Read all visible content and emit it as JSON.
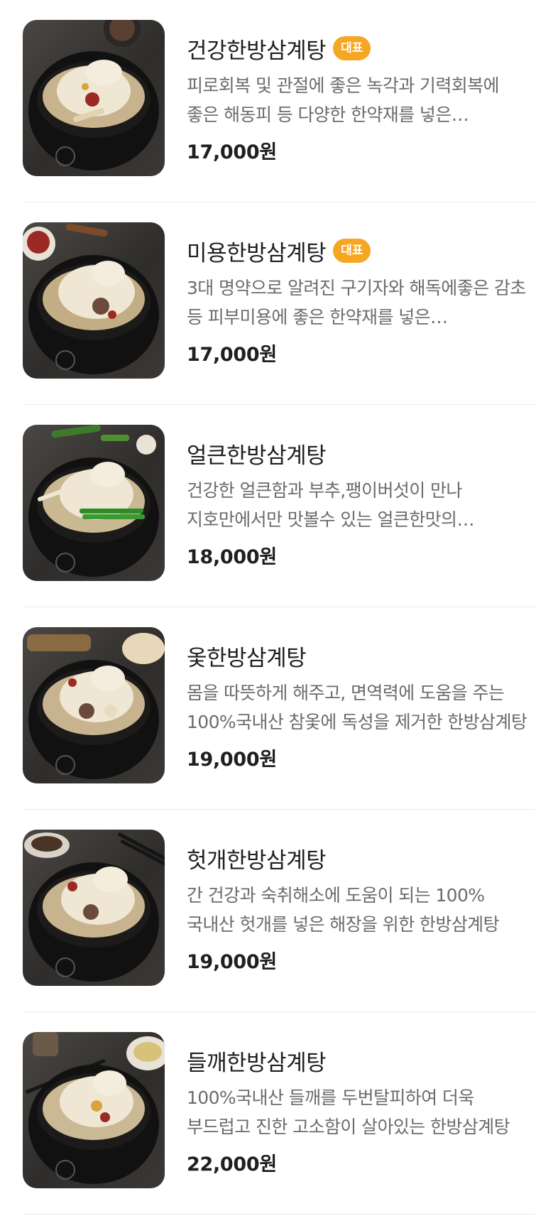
{
  "menu": {
    "items": [
      {
        "name": "건강한방삼계탕",
        "badge": "대표",
        "description": "피로회복 및 관절에 좋은 녹각과 기력회복에 좋은 해동피 등 다양한 한약재를 넣은 건강한방삼계탕",
        "price": "17,000원",
        "image_icon": "samgyetang-photo-icon"
      },
      {
        "name": "미용한방삼계탕",
        "badge": "대표",
        "description": "3대 명약으로 알려진 구기자와 해독에좋은 감초 등 피부미용에 좋은 한약재를 넣은 미용한방삼계탕",
        "price": "17,000원",
        "image_icon": "samgyetang-photo-icon"
      },
      {
        "name": "얼큰한방삼계탕",
        "badge": "",
        "description": "건강한 얼큰함과 부추,팽이버섯이 만나 지호만에서만 맛볼수 있는 얼큰한맛의 한방삼계탕",
        "price": "18,000원",
        "image_icon": "samgyetang-photo-icon"
      },
      {
        "name": "옻한방삼계탕",
        "badge": "",
        "description": "몸을 따뜻하게 해주고, 면역력에 도움을 주는 100%국내산 참옻에 독성을 제거한 한방삼계탕",
        "price": "19,000원",
        "image_icon": "samgyetang-photo-icon"
      },
      {
        "name": "헛개한방삼계탕",
        "badge": "",
        "description": "간 건강과 숙취해소에 도움이 되는 100% 국내산 헛개를 넣은 해장을 위한 한방삼계탕",
        "price": "19,000원",
        "image_icon": "samgyetang-photo-icon"
      },
      {
        "name": "들깨한방삼계탕",
        "badge": "",
        "description": "100%국내산 들깨를 두번탈피하여 더욱 부드럽고 진한 고소함이 살아있는 한방삼계탕",
        "price": "22,000원",
        "image_icon": "samgyetang-photo-icon"
      }
    ]
  },
  "colors": {
    "badge": "#f5a623",
    "price": "#1f1f1f",
    "description": "#6b6b6b",
    "divider": "#ececec"
  }
}
